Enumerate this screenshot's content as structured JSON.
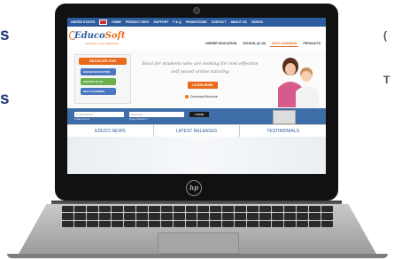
{
  "side_fragments": {
    "left_top": "s",
    "left_bottom": "s",
    "right_top": "(",
    "right_bottom": "T"
  },
  "site": {
    "topnav": {
      "country": "UNITED STATES",
      "items": [
        "HOME",
        "PRODUCT INFO",
        "SUPPORT",
        "F & Q",
        "PROMOTIONS",
        "CONTACT",
        "ABOUT US",
        "VIDEOS"
      ]
    },
    "logo": {
      "name_part1": "Educo",
      "name_part2": "Soft",
      "tagline": "innovation & your happiness"
    },
    "mainnav": [
      "HIGHER EDUCATION",
      "SCHOOL (K-12)",
      "SELF LEARNING",
      "PRODUCTS"
    ],
    "mainnav_active": "SELF LEARNING",
    "register": {
      "title": "REGISTER FOR",
      "options": [
        "HIGHER EDUCATION",
        "SCHOOL (K-12)",
        "SELF LEARNING"
      ],
      "colors": [
        "#4a76c2",
        "#6ab04c",
        "#4a76c2"
      ]
    },
    "hero": {
      "tagline_line1": "Ideal for students who are looking for cost effective",
      "tagline_line2": "self paced online tutoring",
      "cta": "LEARN MORE",
      "download": "Download Brochure"
    },
    "login": {
      "email_placeholder": "Email Address",
      "password_placeholder": "Password",
      "button": "LOGIN",
      "sub_left": "Create Account",
      "sub_right": "Forgot Password ?"
    },
    "tabs": [
      "EDUCO NEWS",
      "LATEST RELEASES",
      "TESTIMONIALS"
    ]
  },
  "device": {
    "brand": "hp"
  },
  "colors": {
    "accent": "#e86a1a",
    "brand_blue": "#2d5c9e",
    "bar_blue": "#3e6ea8"
  }
}
